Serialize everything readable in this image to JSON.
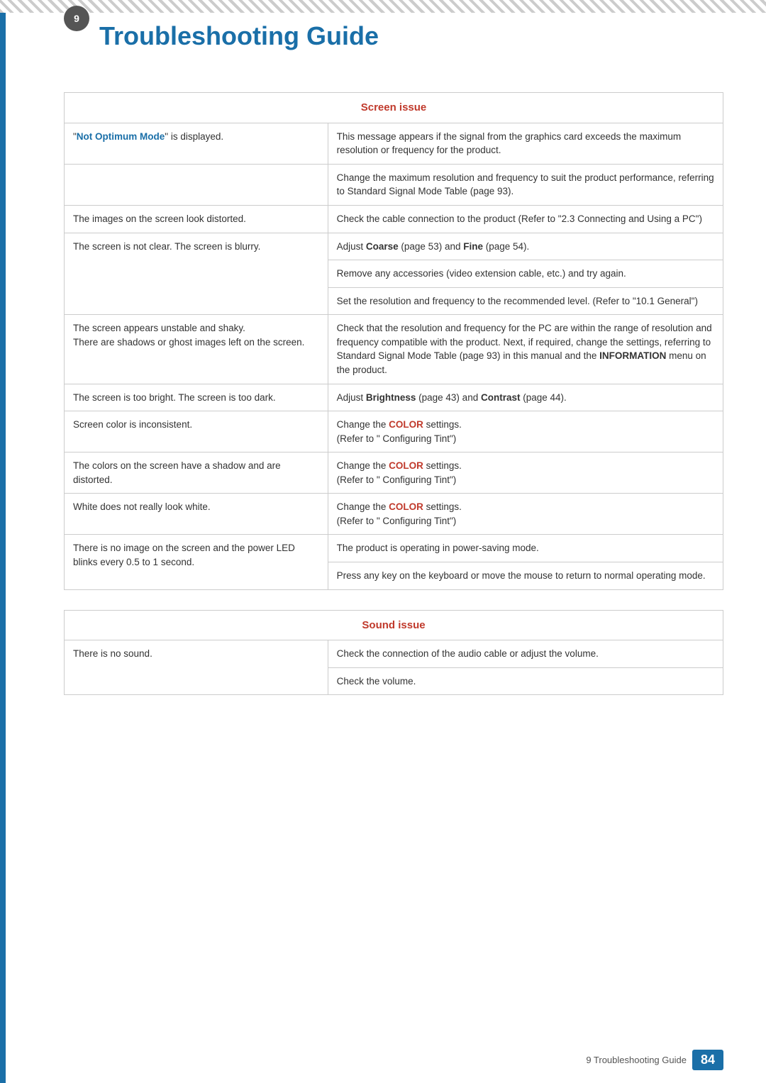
{
  "page": {
    "title": "Troubleshooting Guide",
    "chapter_number": "9",
    "footer_label": "9 Troubleshooting Guide",
    "page_number": "84"
  },
  "screen_issue": {
    "header": "Screen issue",
    "rows": [
      {
        "problem": "\"Not Optimum Mode\" is displayed.",
        "problem_bold": "Not Optimum Mode",
        "solutions": [
          "This message appears if the signal from the graphics card exceeds the maximum resolution or frequency for the product.",
          "Change the maximum resolution and frequency to suit the product performance, referring to Standard Signal Mode Table (page 93)."
        ]
      },
      {
        "problem": "The images on the screen look distorted.",
        "solutions": [
          "Check the cable connection to the product (Refer to \"2.3 Connecting and Using a PC\")"
        ]
      },
      {
        "problem": "The screen is not clear. The screen is blurry.",
        "solutions": [
          "Adjust Coarse (page 53) and Fine (page 54).",
          "Remove any accessories (video extension cable, etc.) and try again.",
          "Set the resolution and frequency to the recommended level. (Refer to \"10.1 General\")"
        ]
      },
      {
        "problem_multi": [
          "The screen appears unstable and shaky.",
          "There are shadows or ghost images left on the screen."
        ],
        "solutions": [
          "Check that the resolution and frequency for the PC are within the range of resolution and frequency compatible with the product. Next, if required, change the settings, referring to Standard Signal Mode Table (page 93) in this manual and the INFORMATION menu on the product."
        ]
      },
      {
        "problem": "The screen is too bright. The screen is too dark.",
        "solutions": [
          "Adjust Brightness (page 43) and Contrast (page 44)."
        ]
      },
      {
        "problem": "Screen color is inconsistent.",
        "solutions": [
          "Change the COLOR settings.",
          "(Refer to \" Configuring Tint\")"
        ],
        "merged_solution": "Change the COLOR settings.\n(Refer to \" Configuring Tint\")"
      },
      {
        "problem": "The colors on the screen have a shadow and are distorted.",
        "solutions": [
          "Change the COLOR settings.",
          "(Refer to \" Configuring Tint\")"
        ],
        "merged_solution": "Change the COLOR settings.\n(Refer to \" Configuring Tint\")"
      },
      {
        "problem": "White does not really look white.",
        "solutions": [
          "Change the COLOR settings.",
          "(Refer to \" Configuring Tint\")"
        ],
        "merged_solution": "Change the COLOR settings.\n(Refer to \" Configuring Tint\")"
      },
      {
        "problem_multi": [
          "There is no image on the screen and the power LED blinks every 0.5 to 1 second."
        ],
        "solutions": [
          "The product is operating in power-saving mode.",
          "Press any key on the keyboard or move the mouse to return to normal operating mode."
        ]
      }
    ]
  },
  "sound_issue": {
    "header": "Sound issue",
    "rows": [
      {
        "problem": "There is no sound.",
        "solutions": [
          "Check the connection of the audio cable or adjust the volume.",
          "Check the volume."
        ]
      }
    ]
  }
}
